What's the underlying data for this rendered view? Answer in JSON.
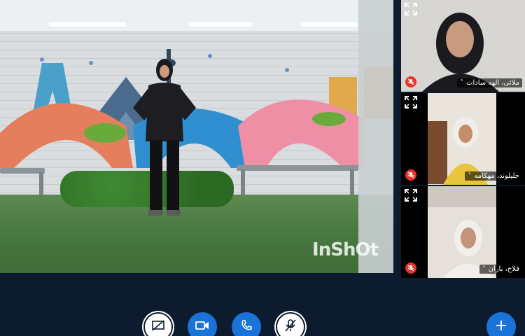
{
  "main_video": {
    "watermark": "InShOt"
  },
  "participants": [
    {
      "name": "ملائی، الهه سادات",
      "mic_icon": "mic-muted-icon"
    },
    {
      "name": "جلیلوند، مهکامه",
      "mic_icon": "mic-muted-icon"
    },
    {
      "name": "فلاح، باران",
      "mic_icon": "mic-muted-icon"
    }
  ],
  "controls": {
    "screen_share_icon": "screen-share-off-icon",
    "video_icon": "video-camera-icon",
    "call_icon": "phone-icon",
    "mic_icon": "mic-off-icon",
    "add_icon": "plus-icon"
  },
  "colors": {
    "background": "#0d1b2e",
    "accent": "#1a73d9",
    "muted_badge": "#e8362b"
  }
}
